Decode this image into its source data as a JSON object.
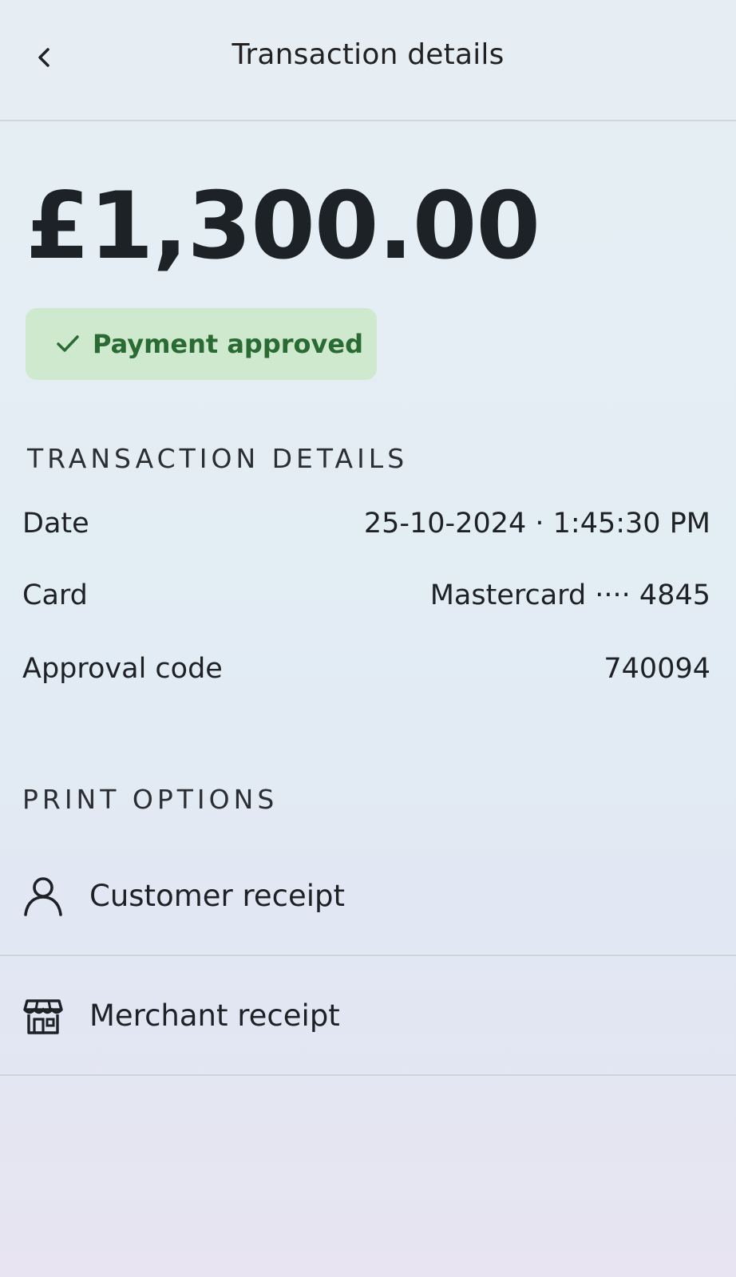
{
  "header": {
    "title": "Transaction details",
    "back_icon": "chevron-left-icon"
  },
  "transaction": {
    "amount": "£1,300.00",
    "status": "Payment approved",
    "status_icon": "check-icon",
    "status_color": "#2a6b33"
  },
  "details": {
    "heading": "TRANSACTION DETAILS",
    "rows": [
      {
        "label": "Date",
        "value": "25-10-2024 · 1:45:30 PM"
      },
      {
        "label": "Card",
        "value": "Mastercard ···· 4845"
      },
      {
        "label": "Approval code",
        "value": "740094"
      }
    ]
  },
  "print_options": {
    "heading": "PRINT OPTIONS",
    "items": [
      {
        "label": "Customer receipt",
        "icon": "person-icon"
      },
      {
        "label": "Merchant receipt",
        "icon": "storefront-icon"
      }
    ]
  }
}
